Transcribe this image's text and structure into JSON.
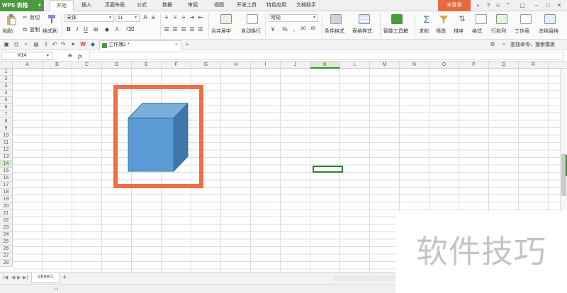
{
  "app": {
    "name": "WPS 表格",
    "login_label": "未登录"
  },
  "menu_tabs": [
    {
      "label": "开始",
      "active": true
    },
    {
      "label": "插入"
    },
    {
      "label": "页面布局"
    },
    {
      "label": "公式"
    },
    {
      "label": "数据"
    },
    {
      "label": "审阅"
    },
    {
      "label": "视图"
    },
    {
      "label": "开发工具"
    },
    {
      "label": "特色应用"
    },
    {
      "label": "文档助手"
    }
  ],
  "ribbon": {
    "paste": "粘贴",
    "cut": "剪切",
    "copy": "复制",
    "format_painter": "格式刷",
    "font_name": "宋体",
    "font_size": "11",
    "bold": "B",
    "italic": "I",
    "underline": "U",
    "font_color_glyph": "A",
    "merge_center": "合并居中",
    "wrap_text": "自动换行",
    "number_format": "常规",
    "currency": "¥",
    "percent": "%",
    "inc_decimal": ".00",
    "dec_decimal": ".00",
    "cond_format": "条件格式",
    "table_style": "表格样式",
    "smart_toolbox": "智能工具箱",
    "sum": "求和",
    "filter": "筛选",
    "sort": "排序",
    "format": "格式",
    "row_col": "行和列",
    "worksheet": "工作表",
    "freeze": "冻结窗格",
    "accent": "#4b9a40"
  },
  "quickbar": {
    "doc_tab": "工作簿2 *",
    "search": "查找命令、搜索模板"
  },
  "formula_bar": {
    "name_box": "K14",
    "fx": "fx"
  },
  "grid": {
    "columns": [
      "A",
      "B",
      "C",
      "D",
      "E",
      "F",
      "G",
      "H",
      "I",
      "J",
      "K",
      "L",
      "M",
      "N",
      "O",
      "P",
      "Q",
      "R"
    ],
    "selected_column": "K",
    "selected_row": "14",
    "rows": [
      "1",
      "2",
      "3",
      "4",
      "5",
      "6",
      "7",
      "8",
      "9",
      "10",
      "11",
      "12",
      "13",
      "14",
      "15",
      "16",
      "17",
      "18",
      "19",
      "20",
      "21",
      "22",
      "23",
      "24",
      "25",
      "26",
      "27",
      "28"
    ]
  },
  "shape": {
    "kind": "cube",
    "fill": "#5b9bd5",
    "frame_color": "#ec6f47"
  },
  "sheets": [
    {
      "name": "Sheet1",
      "active": true
    }
  ],
  "watermark": "软件技巧"
}
